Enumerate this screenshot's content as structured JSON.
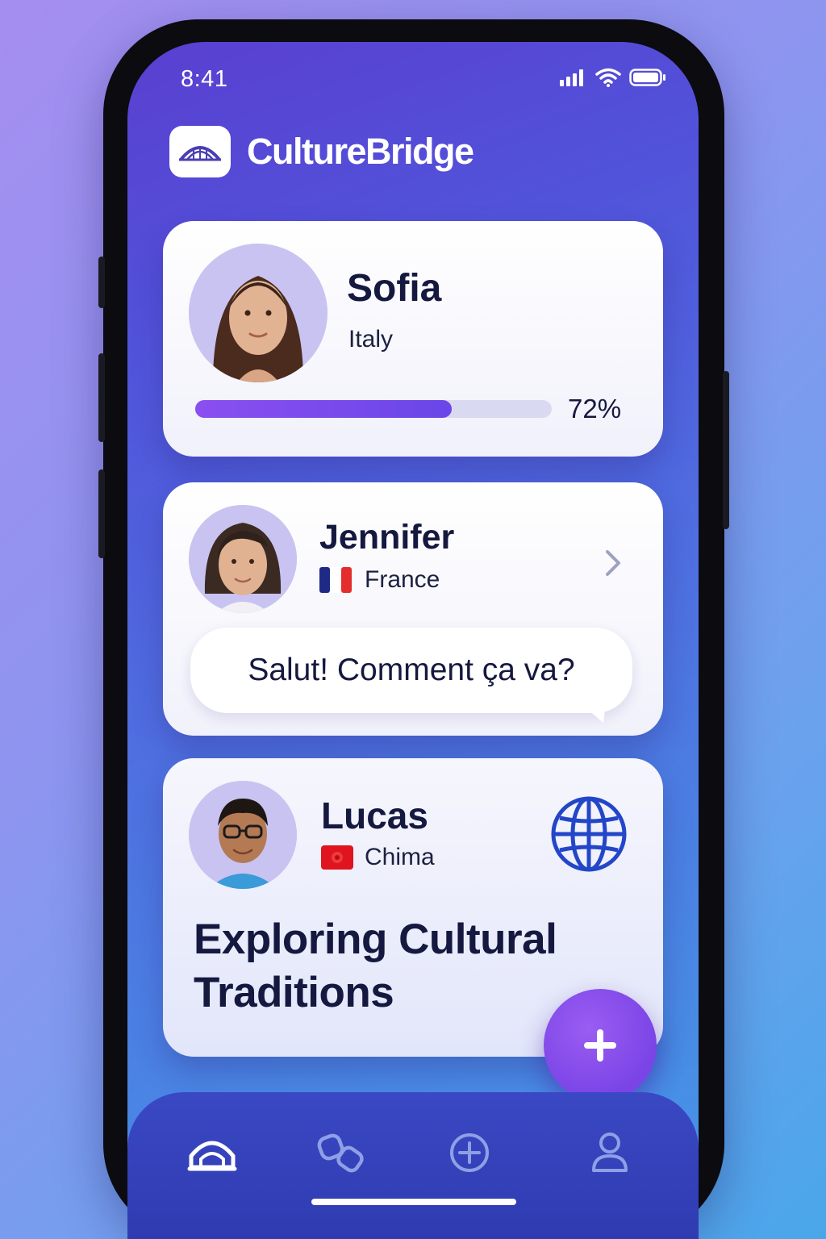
{
  "status_bar": {
    "time": "8:41"
  },
  "app": {
    "name": "CultureBridge"
  },
  "cards": {
    "sofia": {
      "name": "Sofia",
      "country": "Italy",
      "progress_label": "72%",
      "progress": 0.72
    },
    "jennifer": {
      "name": "Jennifer",
      "country": "France",
      "message": "Salut! Comment ça va?"
    },
    "lucas": {
      "name": "Lucas",
      "country": "Chima",
      "headline": "Exploring Cultural Traditions"
    }
  },
  "colors": {
    "accent": "#7a44e6",
    "text_dark": "#15193f",
    "tab_bar": "#3a48c4",
    "globe": "#2346c8"
  },
  "icons": {
    "fab": "plus-icon",
    "tabs": [
      "bridge-home-icon",
      "pills-icon",
      "add-circle-icon",
      "profile-icon"
    ]
  }
}
